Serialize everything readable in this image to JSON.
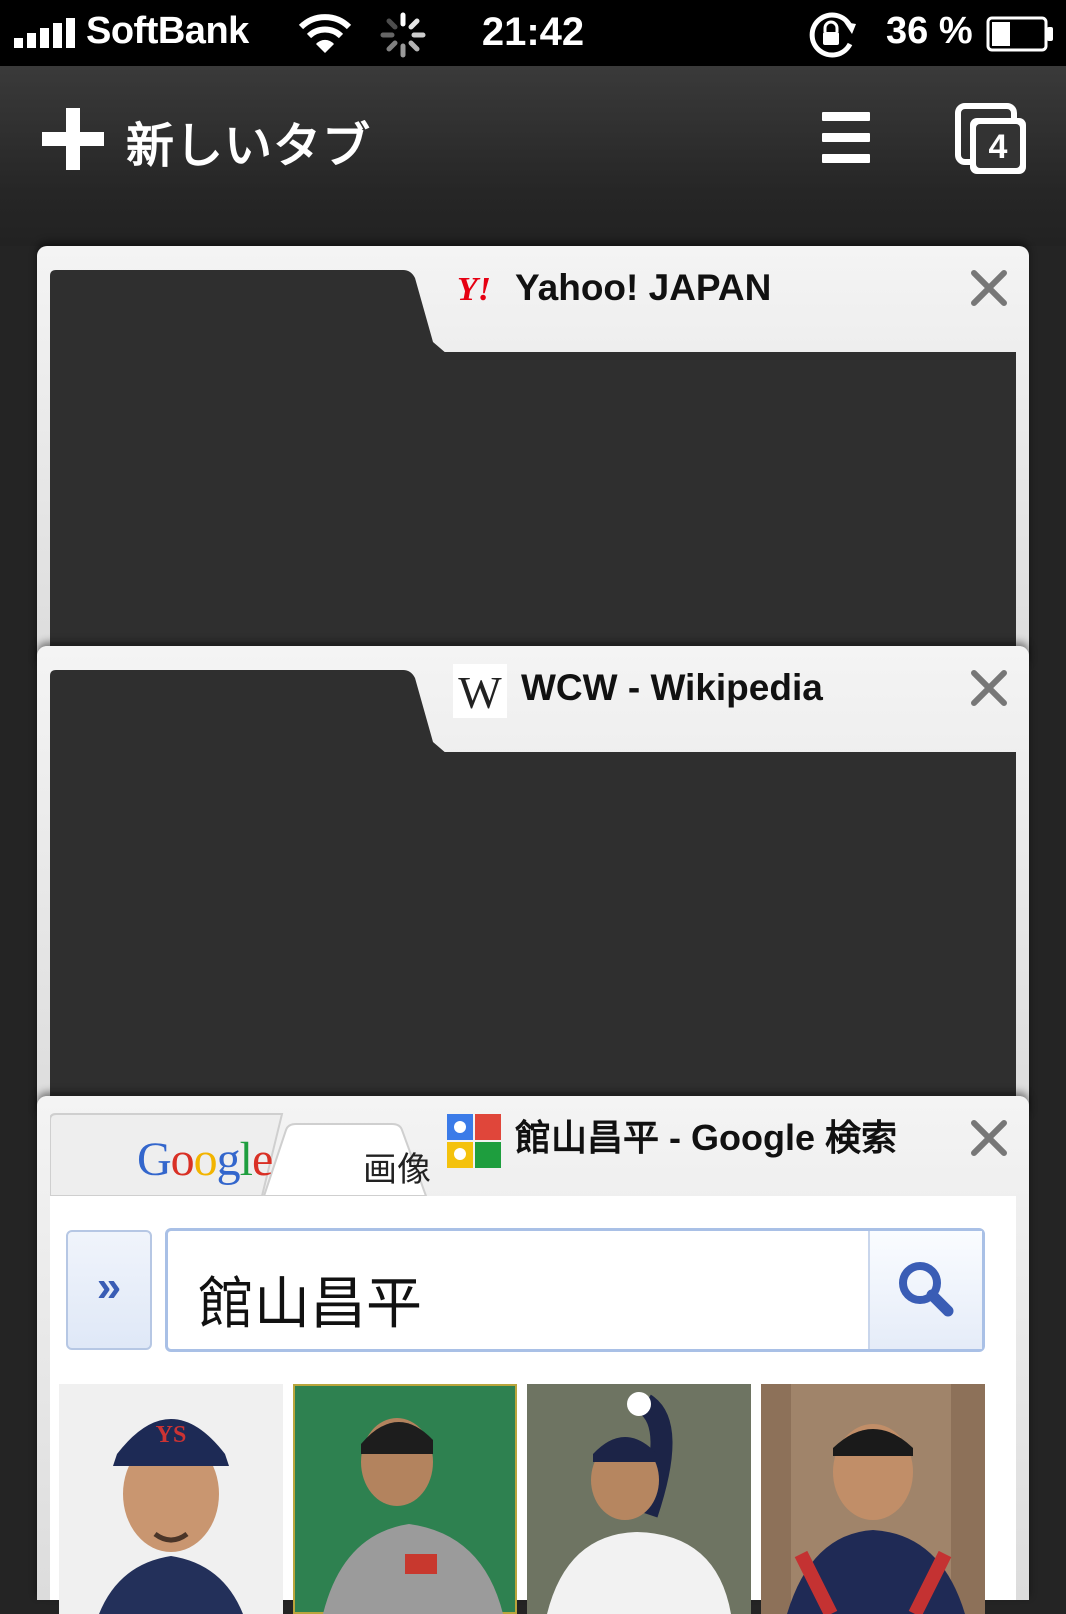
{
  "status_bar": {
    "carrier": "SoftBank",
    "time": "21:42",
    "battery_percent": "36 %",
    "battery_level": 0.36,
    "icons": [
      "signal-icon",
      "wifi-icon",
      "activity-spinner-icon",
      "rotation-lock-icon",
      "battery-icon"
    ]
  },
  "toolbar": {
    "new_tab_label": "新しいタブ",
    "tab_count": "4",
    "icons": [
      "plus-icon",
      "menu-icon",
      "tabs-icon"
    ]
  },
  "tabs": [
    {
      "title": "Yahoo! JAPAN",
      "favicon": "yahoo-icon",
      "favicon_text": "Y!"
    },
    {
      "title": "WCW - Wikipedia",
      "favicon": "wikipedia-icon",
      "favicon_text": "W"
    },
    {
      "title": "館山昌平 - Google 検索",
      "favicon": "google-icon"
    }
  ],
  "google_preview": {
    "logo": "Google",
    "images_tab": "画像",
    "more_button": "»",
    "query": "館山昌平",
    "results": [
      "player-photo-1",
      "player-photo-2",
      "player-photo-3",
      "player-photo-4"
    ]
  },
  "colors": {
    "background": "#242424",
    "card": "#e6e6e6",
    "preview_dark": "#2f2f2f",
    "yahoo_red": "#e60012",
    "google_blue": "#3366cc",
    "search_border": "#a9c0e6"
  }
}
